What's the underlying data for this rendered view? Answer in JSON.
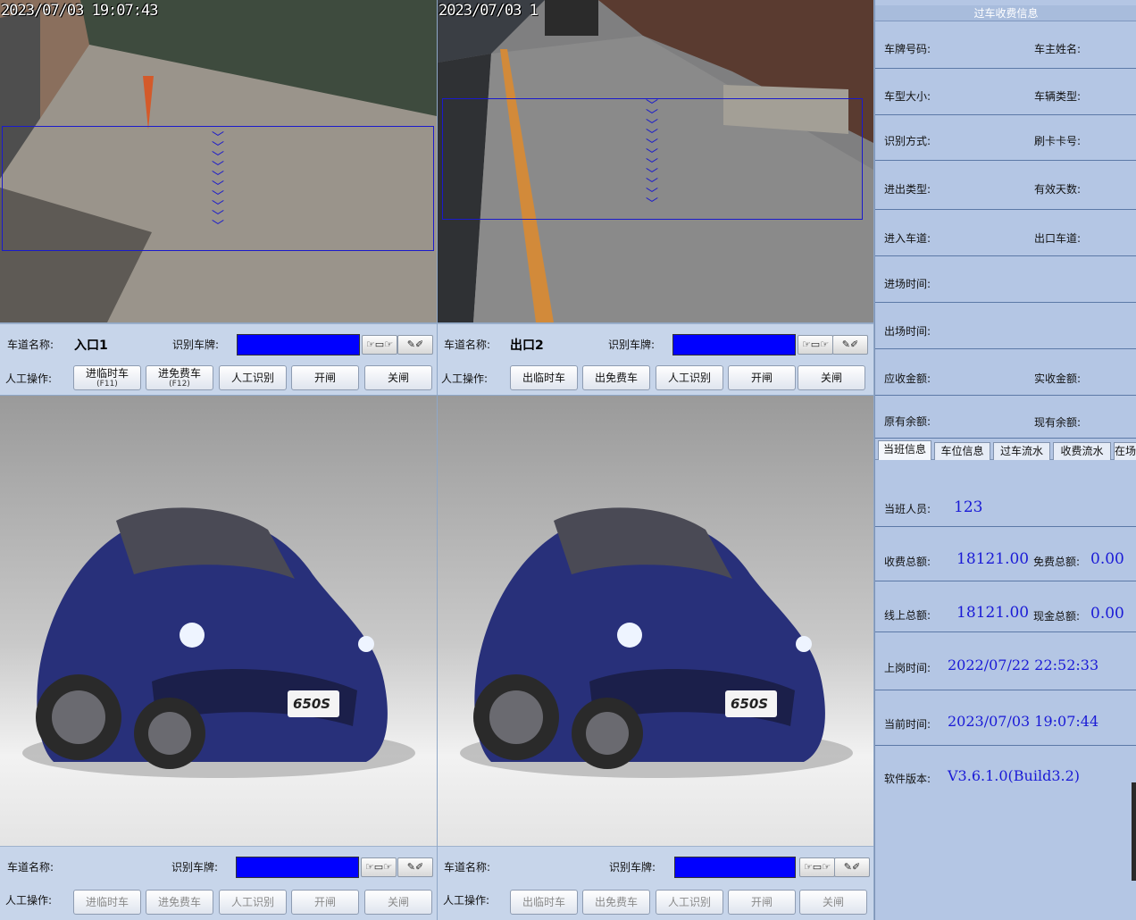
{
  "lanes": [
    {
      "osd": "2023/07/03 19:07:43",
      "name_label": "车道名称:",
      "name_value": "入口1",
      "plate_label": "识别车牌:",
      "manual_label": "人工操作:",
      "buttons": [
        {
          "label": "进临时车",
          "sub": "(F11)"
        },
        {
          "label": "进免费车",
          "sub": "(F12)"
        },
        {
          "label": "人工识别",
          "sub": ""
        },
        {
          "label": "开闸",
          "sub": ""
        },
        {
          "label": "关闸",
          "sub": ""
        }
      ]
    },
    {
      "osd": "2023/07/03 1",
      "name_label": "车道名称:",
      "name_value": "出口2",
      "plate_label": "识别车牌:",
      "manual_label": "人工操作:",
      "buttons": [
        {
          "label": "出临时车",
          "sub": ""
        },
        {
          "label": "出免费车",
          "sub": ""
        },
        {
          "label": "人工识别",
          "sub": ""
        },
        {
          "label": "开闸",
          "sub": ""
        },
        {
          "label": "关闸",
          "sub": ""
        }
      ]
    },
    {
      "name_label": "车道名称:",
      "name_value": "",
      "plate_label": "识别车牌:",
      "manual_label": "人工操作:",
      "buttons": [
        {
          "label": "进临时车",
          "sub": ""
        },
        {
          "label": "进免费车",
          "sub": ""
        },
        {
          "label": "人工识别",
          "sub": ""
        },
        {
          "label": "开闸",
          "sub": ""
        },
        {
          "label": "关闸",
          "sub": ""
        }
      ]
    },
    {
      "name_label": "车道名称:",
      "name_value": "",
      "plate_label": "识别车牌:",
      "manual_label": "人工操作:",
      "buttons": [
        {
          "label": "出临时车",
          "sub": ""
        },
        {
          "label": "出免费车",
          "sub": ""
        },
        {
          "label": "人工识别",
          "sub": ""
        },
        {
          "label": "开闸",
          "sub": ""
        },
        {
          "label": "关闸",
          "sub": ""
        }
      ]
    }
  ],
  "icons": {
    "capture": "hand-pointer-icon",
    "edit": "pen-edit-icon"
  },
  "colors": {
    "plate_bg": "#0000ff",
    "value_text": "#1a1ad6"
  },
  "fee_panel": {
    "title": "过车收费信息",
    "rows": [
      {
        "left": "车牌号码:",
        "right": "车主姓名:"
      },
      {
        "left": "车型大小:",
        "right": "车辆类型:"
      },
      {
        "left": "识别方式:",
        "right": "刷卡卡号:"
      },
      {
        "left": "进出类型:",
        "right": "有效天数:"
      },
      {
        "left": "进入车道:",
        "right": "出口车道:"
      },
      {
        "left": "进场时间:",
        "right": ""
      },
      {
        "left": "出场时间:",
        "right": ""
      },
      {
        "left": "应收金额:",
        "right": "实收金额:"
      },
      {
        "left": "原有余额:",
        "right": "现有余额:"
      }
    ]
  },
  "tabs": [
    "当班信息",
    "车位信息",
    "过车流水",
    "收费流水",
    "在场"
  ],
  "shift": {
    "staff_label": "当班人员:",
    "staff_value": "123",
    "fee_total_label": "收费总额:",
    "fee_total_value": "18121.00",
    "free_total_label": "免费总额:",
    "free_total_value": "0.00",
    "online_total_label": "线上总额:",
    "online_total_value": "18121.00",
    "cash_total_label": "现金总额:",
    "cash_total_value": "0.00",
    "on_duty_label": "上岗时间:",
    "on_duty_value": "2022/07/22 22:52:33",
    "current_label": "当前时间:",
    "current_value": "2023/07/03 19:07:44",
    "version_label": "软件版本:",
    "version_value": "V3.6.1.0(Build3.2)"
  },
  "car_badge": "650S"
}
